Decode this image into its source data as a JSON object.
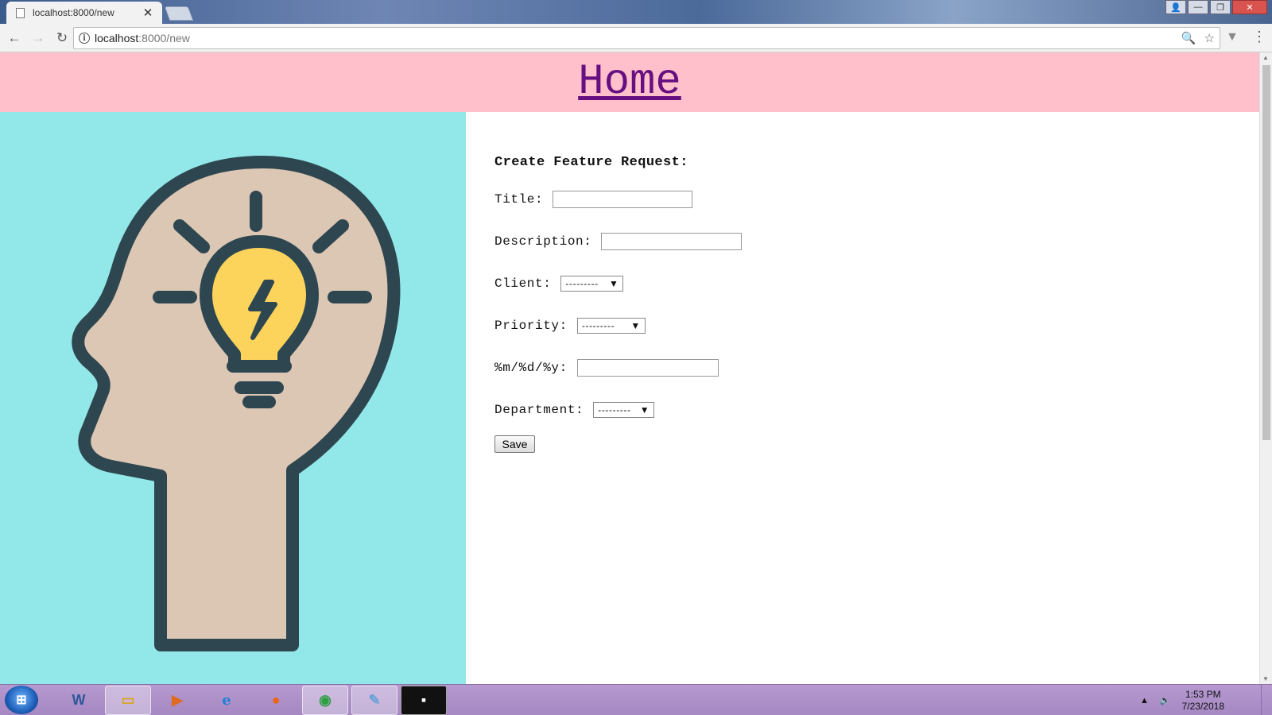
{
  "browser": {
    "tab_title": "localhost:8000/new",
    "url_host": "localhost",
    "url_path": ":8000/new"
  },
  "page": {
    "header_link": "Home",
    "header_bg": "#ffc0cb",
    "illustration_bg": "#92e8e8",
    "illustration": "head-with-lightbulb"
  },
  "form": {
    "title": "Create Feature Request:",
    "title_label": "Title:",
    "title_value": "",
    "description_label": "Description:",
    "description_value": "",
    "client_label": "Client:",
    "client_selected": "---------",
    "priority_label": "Priority:",
    "priority_selected": "---------",
    "date_label": "%m/%d/%y:",
    "date_value": "",
    "department_label": "Department:",
    "department_selected": "---------",
    "save_label": "Save"
  },
  "taskbar": {
    "time": "1:53 PM",
    "date": "7/23/2018",
    "apps": [
      "word",
      "file-explorer",
      "media-player",
      "internet-explorer",
      "firefox",
      "chrome",
      "notepad",
      "command-prompt"
    ]
  }
}
